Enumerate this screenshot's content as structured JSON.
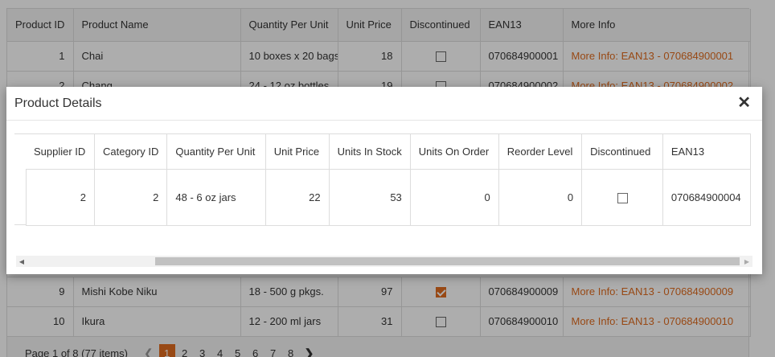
{
  "grid": {
    "columns": [
      "Product ID",
      "Product Name",
      "Quantity Per Unit",
      "Unit Price",
      "Discontinued",
      "EAN13",
      "More Info"
    ],
    "rows_top": [
      {
        "id": "1",
        "name": "Chai",
        "qty": "10 boxes x 20 bags",
        "price": "18",
        "discontinued": false,
        "ean": "070684900001",
        "info": "More Info: EAN13 - 070684900001"
      },
      {
        "id": "2",
        "name": "Chang",
        "qty": "24 - 12 oz bottles",
        "price": "19",
        "discontinued": false,
        "ean": "070684900002",
        "info": "More Info: EAN13 - 070684900002"
      }
    ],
    "rows_bottom": [
      {
        "id": "9",
        "name": "Mishi Kobe Niku",
        "qty": "18 - 500 g pkgs.",
        "price": "97",
        "discontinued": true,
        "ean": "070684900009",
        "info": "More Info: EAN13 - 070684900009"
      },
      {
        "id": "10",
        "name": "Ikura",
        "qty": "12 - 200 ml jars",
        "price": "31",
        "discontinued": false,
        "ean": "070684900010",
        "info": "More Info: EAN13 - 070684900010"
      }
    ]
  },
  "pager": {
    "info": "Page 1 of 8 (77 items)",
    "pages": [
      "1",
      "2",
      "3",
      "4",
      "5",
      "6",
      "7",
      "8"
    ],
    "active_page": "1",
    "prev_icon": "chevron-left-icon",
    "next_icon": "chevron-right-icon"
  },
  "modal": {
    "title": "Product Details",
    "close_icon": "close-icon",
    "columns": [
      "Supplier ID",
      "Category ID",
      "Quantity Per Unit",
      "Unit Price",
      "Units In Stock",
      "Units On Order",
      "Reorder Level",
      "Discontinued",
      "EAN13"
    ],
    "row": {
      "supplier_id": "2",
      "category_id": "2",
      "qty": "48 - 6 oz jars",
      "price": "22",
      "in_stock": "53",
      "on_order": "0",
      "reorder": "0",
      "discontinued": false,
      "ean": "070684900004"
    }
  },
  "colors": {
    "accent": "#e06c1f",
    "overlay": "rgba(0,0,0,0.32)",
    "border": "#dddddd"
  }
}
